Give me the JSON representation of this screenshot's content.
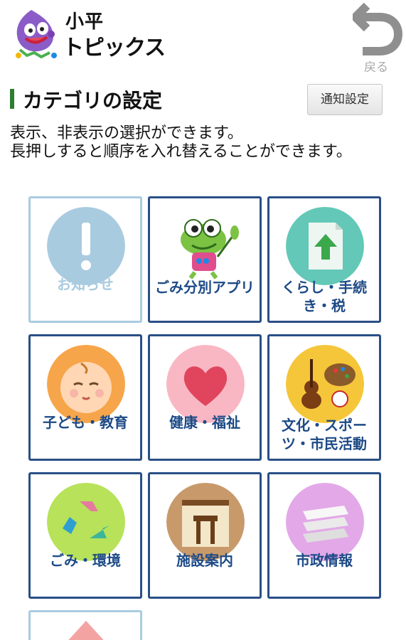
{
  "app": {
    "title_line1": "小平",
    "title_line2": "トピックス"
  },
  "header": {
    "back_label": "戻る"
  },
  "page": {
    "title": "カテゴリの設定",
    "notify_button": "通知設定",
    "description": "表示、非表示の選択ができます。\n長押しすると順序を入れ替えることができます。"
  },
  "categories": [
    {
      "label": "お知らせ",
      "icon": "exclamation-icon",
      "enabled": false
    },
    {
      "label": "ごみ分別アプリ",
      "icon": "frog-mascot-icon",
      "enabled": true
    },
    {
      "label": "くらし・手続き・税",
      "icon": "document-arrow-icon",
      "enabled": true
    },
    {
      "label": "子ども・教育",
      "icon": "baby-face-icon",
      "enabled": true
    },
    {
      "label": "健康・福祉",
      "icon": "heart-icon",
      "enabled": true
    },
    {
      "label": "文化・スポーツ・市民活動",
      "icon": "violin-palette-icon",
      "enabled": true
    },
    {
      "label": "ごみ・環境",
      "icon": "recycle-icon",
      "enabled": true
    },
    {
      "label": "施設案内",
      "icon": "building-icon",
      "enabled": true
    },
    {
      "label": "市政情報",
      "icon": "layers-icon",
      "enabled": true
    },
    {
      "label": "",
      "icon": "home-icon",
      "enabled": false
    }
  ],
  "colors": {
    "tile_border": "#2a4f86",
    "tile_border_disabled": "#a9cbe0",
    "label": "#1d4a86",
    "title_accent": "#2e7d32"
  }
}
